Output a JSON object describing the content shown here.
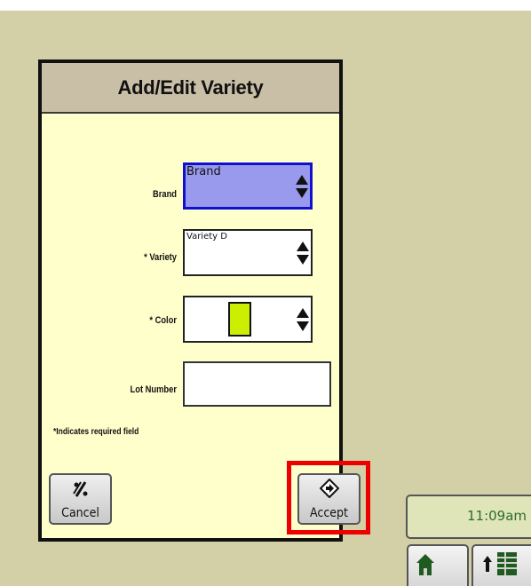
{
  "dialog": {
    "title": "Add/Edit Variety",
    "fields": {
      "brand": {
        "label": "Brand",
        "value": "Brand"
      },
      "variety": {
        "label": "* Variety",
        "value": "Variety D"
      },
      "color": {
        "label": "* Color",
        "swatch_color": "#ccee00"
      },
      "lot_number": {
        "label": "Lot Number",
        "value": ""
      }
    },
    "note": "*Indicates required field",
    "buttons": {
      "cancel": "Cancel",
      "accept": "Accept"
    }
  },
  "status": {
    "time": "11:09am"
  },
  "colors": {
    "background": "#d3cfa7",
    "dialog_body": "#ffffcc",
    "header": "#c9bfa7",
    "active_field": "#9999ee",
    "highlight": "#ee0000",
    "clock_text": "#2e6b2e"
  }
}
